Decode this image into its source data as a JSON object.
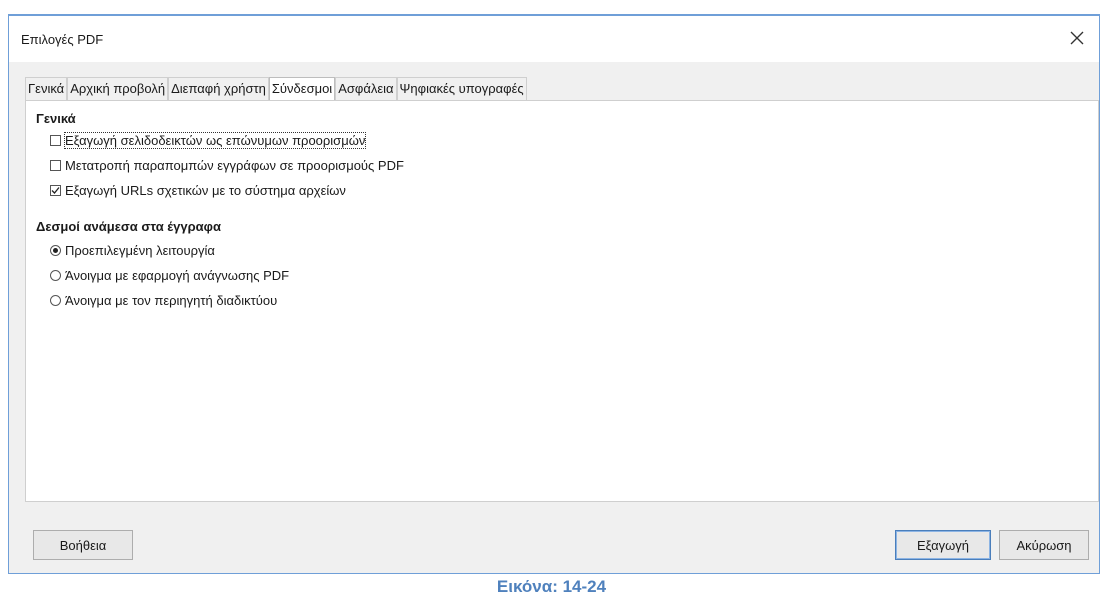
{
  "window": {
    "title": "Επιλογές PDF",
    "close_icon": "close-icon"
  },
  "tabs": [
    {
      "label": "Γενικά"
    },
    {
      "label": "Αρχική προβολή"
    },
    {
      "label": "Διεπαφή χρήστη"
    },
    {
      "label": "Σύνδεσμοι"
    },
    {
      "label": "Ασφάλεια"
    },
    {
      "label": "Ψηφιακές υπογραφές"
    }
  ],
  "active_tab": "Σύνδεσμοι",
  "general": {
    "title": "Γενικά",
    "options": [
      {
        "label": "Εξαγωγή σελιδοδεικτών ως επώνυμων προορισμών",
        "checked": false
      },
      {
        "label": "Μετατροπή παραπομπών εγγράφων σε προορισμούς PDF",
        "checked": false
      },
      {
        "label": "Εξαγωγή URLs σχετικών με το σύστημα αρχείων",
        "checked": true
      }
    ]
  },
  "cross_doc": {
    "title": "Δεσμοί ανάμεσα στα έγγραφα",
    "options": [
      {
        "label": "Προεπιλεγμένη λειτουργία",
        "selected": true
      },
      {
        "label": "Άνοιγμα με εφαρμογή ανάγνωσης PDF",
        "selected": false
      },
      {
        "label": "Άνοιγμα με τον περιηγητή διαδικτύου",
        "selected": false
      }
    ]
  },
  "buttons": {
    "help": "Βοήθεια",
    "export": "Εξαγωγή",
    "cancel": "Ακύρωση"
  },
  "caption": "Εικόνα: 14-24",
  "colors": {
    "accent": "#4f81bd",
    "border": "#6f9fd8"
  }
}
